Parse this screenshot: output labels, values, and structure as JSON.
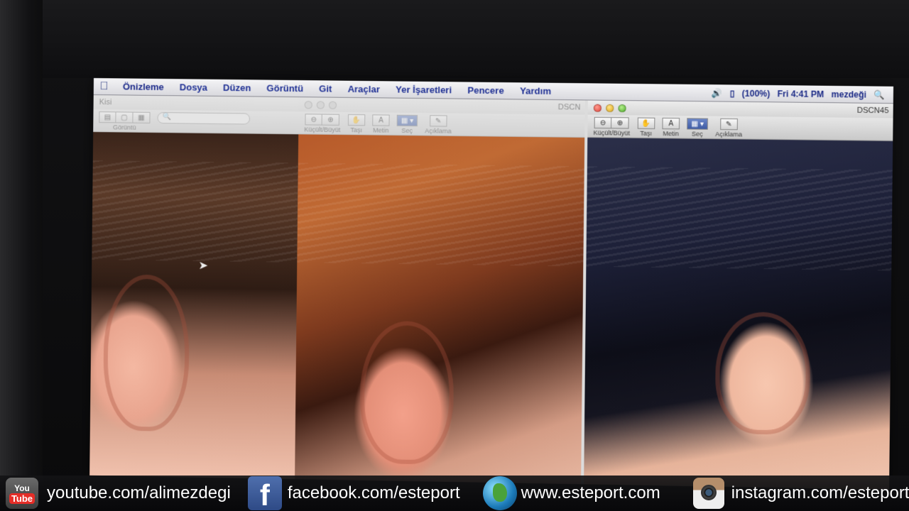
{
  "menubar": {
    "apple": "",
    "items": [
      "Önizleme",
      "Dosya",
      "Düzen",
      "Görüntü",
      "Git",
      "Araçlar",
      "Yer İşaretleri",
      "Pencere",
      "Yardım"
    ],
    "status": {
      "battery": "(100%)",
      "clock": "Fri 4:41 PM",
      "user": "mezdeği"
    }
  },
  "windows": {
    "left": {
      "toolbar_label": "Görüntü",
      "title_stub": "Kisi"
    },
    "middle": {
      "title": "DSCN",
      "toolbar": {
        "zoom": "Küçült/Büyüt",
        "move": "Taşı",
        "text": "Metin",
        "select": "Seç",
        "annotate": "Açıklama"
      }
    },
    "right": {
      "title": "DSCN45",
      "toolbar": {
        "zoom": "Küçült/Büyüt",
        "move": "Taşı",
        "text": "Metin",
        "select": "Seç",
        "annotate": "Açıklama"
      }
    }
  },
  "social": {
    "youtube": {
      "icon_top": "You",
      "icon_bottom": "Tube",
      "text": "youtube.com/alimezdegi"
    },
    "facebook": {
      "text": "facebook.com/esteport"
    },
    "web": {
      "text": "www.esteport.com"
    },
    "instagram": {
      "text": "instagram.com/esteport"
    }
  }
}
